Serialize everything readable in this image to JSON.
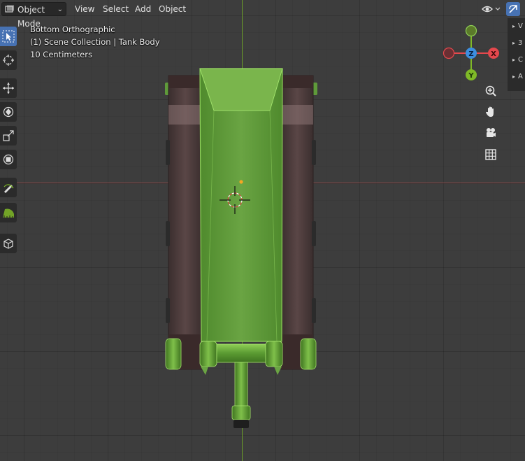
{
  "header": {
    "mode_label": "Object Mode",
    "menus": [
      "View",
      "Select",
      "Add",
      "Object"
    ]
  },
  "overlay": {
    "view_name": "Bottom Orthographic",
    "collection": "(1) Scene Collection | Tank Body",
    "scale": "10 Centimeters"
  },
  "toolbar": {
    "tools": [
      "select-box-icon",
      "cursor-icon",
      "move-icon",
      "rotate-icon",
      "scale-icon",
      "transform-icon",
      "annotate-icon",
      "measure-icon",
      "add-cube-icon"
    ],
    "active_tool": "select-box-icon"
  },
  "gizmo": {
    "axes": {
      "x": "X",
      "y": "Y",
      "z": "Z"
    },
    "colors": {
      "x": "#e5484d",
      "y": "#7fb927",
      "z": "#3d8fe0"
    }
  },
  "sidebar_tabs": [
    "V",
    "3",
    "C",
    "A"
  ],
  "colors": {
    "accent": "#4772b3",
    "tank_green": "#5f9a3a",
    "tread_brown": "#4a3a3a",
    "axis_x": "#8a4a4a",
    "axis_y": "#6a9a2a"
  }
}
